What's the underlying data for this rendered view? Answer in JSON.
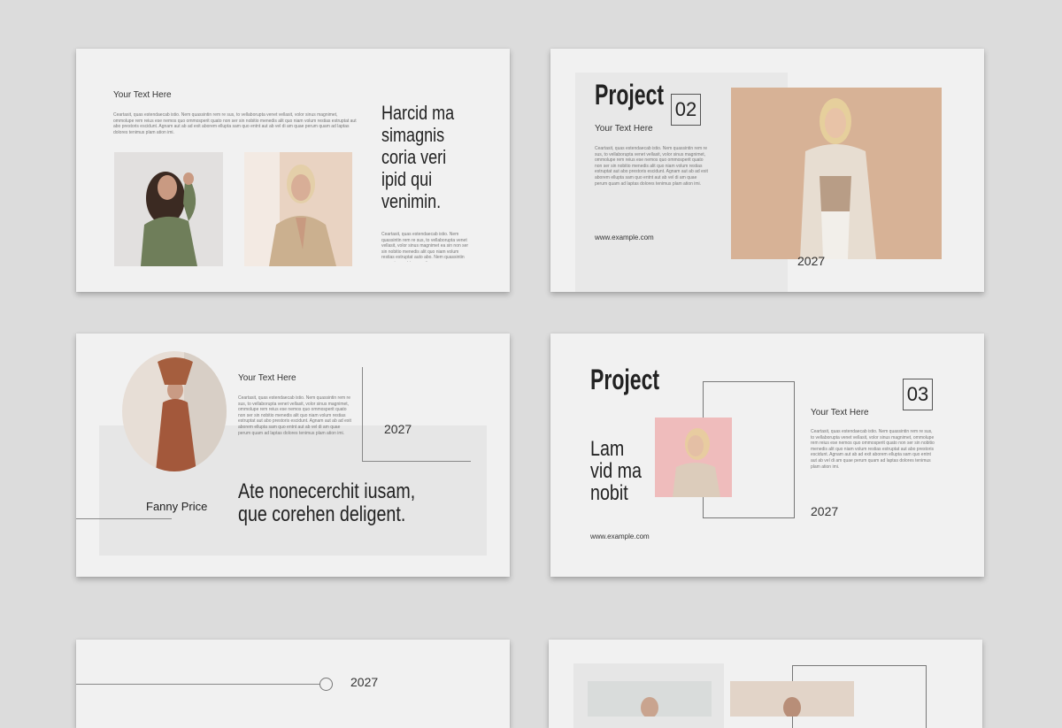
{
  "slide1": {
    "title": "Your Text Here",
    "body": "Ceartasit, quas estendaecab istio. Nem quassintin rem re sus, to vellaborupta venet vellasit, volor sinus magnimet, ommolupe rem reius ese nemos quo ommosperit quato non ser sin nobitio menedis alit quo niam volum restias estruptat aut abo prestoris escidunt. Agnam aut ab ad exit aborem ellupta sam quo entnt aut ab vel di am quae perum quam ad laptas dolores tenimus plam ation imi.",
    "quote": [
      "Harcid ma",
      "simagnis",
      "coria veri",
      "ipid qui",
      "venimin."
    ],
    "caption": "Ceartasit, quas estendaecab istio. Nem quassintin rem re sus, to vellaborupta venet vellasit, volor sinus magnimet ea sin non ser sin nobitio menedis alit quo niam volum restias estruptat auto abo. Nem quassintin rem rei su est to cornstio ossum."
  },
  "slide2": {
    "title": "Project",
    "number": "02",
    "subtitle": "Your Text Here",
    "body": "Ceartasit, quas estendaecab istio. Nem quassintin rem re sus, to vellaborupta venet vellasit, volor sinus magnimet, ommolupe rem reius ese nemos quo ommosperit quato non ser sin nobitio menedis alit quo niam volum restias estruptat aut abo prestoris escidunt. Agnam aut ab ad exit aborem ellupta sam quo entnt aut ab vel di am quae perum quam ad laptas dolores tenimus plam ation imi.",
    "url": "www.example.com",
    "year": "2027"
  },
  "slide3": {
    "title": "Your Text Here",
    "body": "Ceartasit, quas estendaecab istio. Nem quassintin rem re sus, to vellaborupta venet vellasit, volor sinus magnimet, ommolupe rem reius ese nemos quo ommosperit quato non ser sin nobitio menedis alit quo niam volum restias estruptat aut abo prestoris escidunt. Agnam aut ab ad exit aborem ellupta sam quo entnt aut ab vel di am quae perum quam ad laptas dolores tenimus plam ation imi.",
    "year": "2027",
    "name": "Fanny Price",
    "quote": [
      "Ate nonecerchit iusam,",
      "que corehen deligent."
    ]
  },
  "slide4": {
    "title": "Project",
    "number": "03",
    "quote": [
      "Lam",
      "vid ma",
      "nobit"
    ],
    "subtitle": "Your Text Here",
    "body": "Ceartasit, quas estendaecab istio. Nem quassintin rem re sus, to vellaborupta venet vellasit, volor sinus magnimet, ommolupe rem reius ese nemos quo ommosperit quato non ser sin nobitio menedis alit quo niam volum restias estruptat aut abo prestoris escidunt. Agnam aut ab ad exit aborem ellupta sam quo entnt aut ab vel di am quae perum quam ad laptas dolores tenimus plam ation imi.",
    "url": "www.example.com",
    "year": "2027"
  },
  "slide5": {
    "year": "2027"
  },
  "colors": {
    "background": "#dcdcdc",
    "slide": "#f1f1f1",
    "accent_beige": "#d9b49b",
    "accent_pink": "#efbcbc"
  }
}
